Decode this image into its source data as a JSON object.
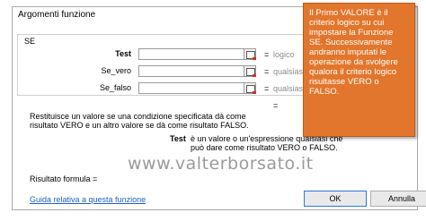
{
  "dialog": {
    "title": "Argomenti funzione",
    "help_glyph": "?",
    "close_glyph": "✕"
  },
  "function_group": {
    "name": "SE",
    "args": [
      {
        "label": "Test",
        "value": "",
        "eq": "=",
        "result_type": "logico"
      },
      {
        "label": "Se_vero",
        "value": "",
        "eq": "=",
        "result_type": "qualsiasi"
      },
      {
        "label": "Se_falso",
        "value": "",
        "eq": "=",
        "result_type": "qualsiasi"
      }
    ]
  },
  "function_eq": "=",
  "description": "Restituisce un valore se una condizione specificata dà come risultato VERO e un altro valore se dà come risultato FALSO.",
  "arg_help": {
    "name": "Test",
    "text": "è un valore o un'espressione qualsiasi che può dare come risultato VERO o FALSO."
  },
  "watermark": "www.valterborsato.it",
  "result_label": "Risultato formula =",
  "help_link": "Guida relativa a questa funzione",
  "buttons": {
    "ok": "OK",
    "cancel": "Annulla"
  },
  "callout": "Il Primo VALORE è il criterio logico su cui impostare la Funzione SE. Successivamente andranno imputati le operazione da svolgere qualora il criterio logico risultasse VERO o FALSO.",
  "colors": {
    "callout_bg": "#e2762c",
    "link": "#1f5fbf",
    "ok_border": "#2a7ad6"
  }
}
